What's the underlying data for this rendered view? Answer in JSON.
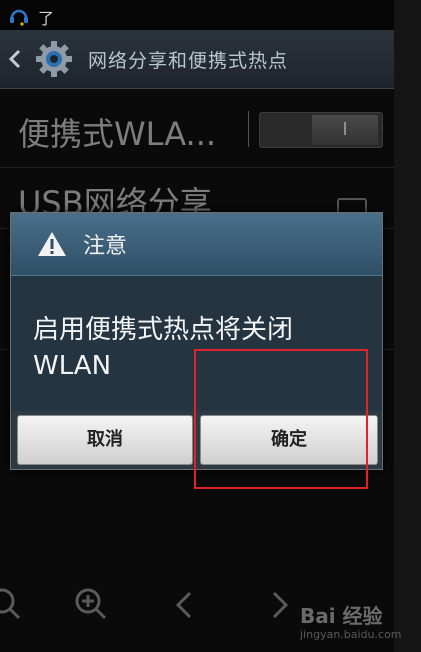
{
  "status_bar": {
    "text": "了"
  },
  "action_bar": {
    "title": "网络分享和便携式热点"
  },
  "settings": [
    {
      "label": "便携式WLA...",
      "toggle_label": "I",
      "toggle_state": "off"
    },
    {
      "label": "USB网络分享",
      "checked": false
    }
  ],
  "dialog": {
    "title": "注意",
    "message": "启用便携式热点将关闭WLAN",
    "cancel_label": "取消",
    "confirm_label": "确定"
  },
  "annotation": {
    "highlight_color": "#e0222a"
  },
  "watermark": {
    "logo": "Bai 经验",
    "url": "jingyan.baidu.com"
  },
  "colors": {
    "dialog_header": "#3d6079",
    "dialog_body": "#243440",
    "button": "#e6e6e6"
  }
}
